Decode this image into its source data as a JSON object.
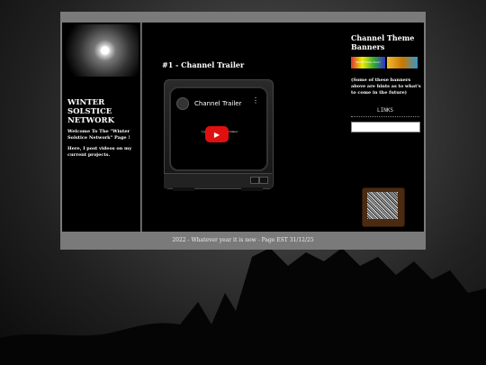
{
  "sidebar_left": {
    "title": "WINTER SOLSTICE NETWORK",
    "welcome": "Welcome To The \"Winter Solstice Network\" Page !",
    "intro": "Here, I post videos on my current projects."
  },
  "main": {
    "post_title": "#1 - Channel Trailer",
    "video": {
      "title": "Channel Trailer",
      "caption": "I put what I… …ew videos",
      "menu_icon": "more-vert-icon",
      "play_icon": "youtube-play-icon"
    }
  },
  "sidebar_right": {
    "title": "Channel Theme Banners",
    "banner1_text": "WICK Films Now!",
    "note": "(Some of these banners above are hints as to what's to come in the future)",
    "links_label": "LINKS"
  },
  "footer": {
    "text": "2022 - Whatever year it is now - Page EST 31/12/25"
  },
  "colors": {
    "frame": "#7a7a7a",
    "column_bg": "#000000",
    "play_button": "#e01010"
  }
}
